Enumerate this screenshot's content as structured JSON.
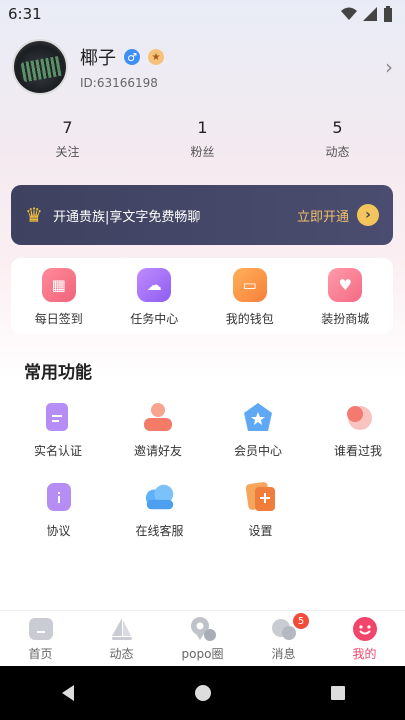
{
  "status": {
    "time": "6:31"
  },
  "profile": {
    "name": "椰子",
    "uid": "ID:63166198",
    "gender_symbol": "♂",
    "level_symbol": "★"
  },
  "stats": [
    {
      "value": "7",
      "label": "关注"
    },
    {
      "value": "1",
      "label": "粉丝"
    },
    {
      "value": "5",
      "label": "动态"
    }
  ],
  "vip": {
    "text": "开通贵族|享文字免费畅聊",
    "action": "立即开通"
  },
  "quick": [
    {
      "label": "每日签到",
      "icon": "calendar-icon",
      "color": "#f0647a"
    },
    {
      "label": "任务中心",
      "icon": "task-bell-icon",
      "color": "#a76ef0"
    },
    {
      "label": "我的钱包",
      "icon": "wallet-icon",
      "color": "#f7893a"
    },
    {
      "label": "装扮商城",
      "icon": "heart-gift-icon",
      "color": "#f46a86"
    }
  ],
  "section": {
    "title": "常用功能"
  },
  "features": [
    {
      "label": "实名认证",
      "icon": "id-card-icon"
    },
    {
      "label": "邀请好友",
      "icon": "invite-friends-icon"
    },
    {
      "label": "会员中心",
      "icon": "member-star-icon"
    },
    {
      "label": "谁看过我",
      "icon": "visitors-icon"
    },
    {
      "label": "协议",
      "icon": "agreement-icon"
    },
    {
      "label": "在线客服",
      "icon": "customer-service-icon"
    },
    {
      "label": "设置",
      "icon": "settings-icon"
    }
  ],
  "tabs": [
    {
      "label": "首页",
      "icon": "home-icon"
    },
    {
      "label": "动态",
      "icon": "sail-icon"
    },
    {
      "label": "popo圈",
      "icon": "location-icon"
    },
    {
      "label": "消息",
      "icon": "message-icon",
      "badge": "5"
    },
    {
      "label": "我的",
      "icon": "smile-icon",
      "active": true
    }
  ],
  "colors": {
    "accent": "#f2456b",
    "vip_bg": "#3f4160",
    "vip_action": "#f0c06a"
  }
}
